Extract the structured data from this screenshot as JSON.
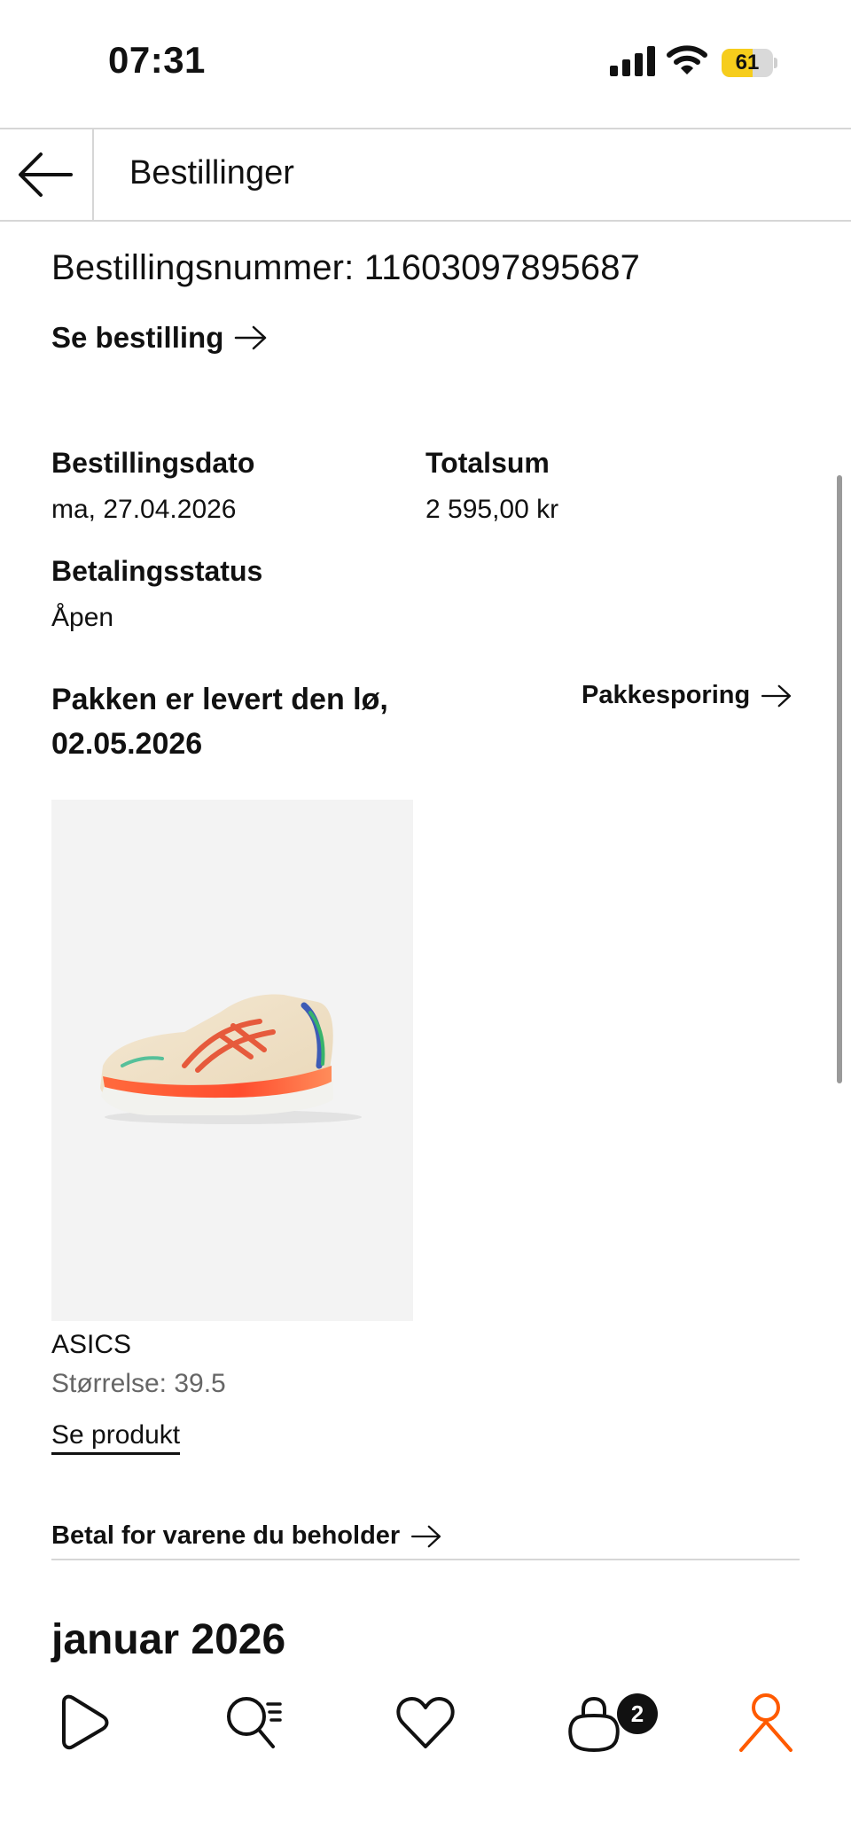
{
  "status_bar": {
    "time": "07:31",
    "battery": "61",
    "battery_level": 0.61
  },
  "header": {
    "title": "Bestillinger"
  },
  "order": {
    "number_label": "Bestillingsnummer: 11603097895687",
    "see_order": "Se bestilling",
    "order_date_label": "Bestillingsdato",
    "order_date": "ma, 27.04.2026",
    "total_label": "Totalsum",
    "total": "2 595,00 kr",
    "payment_status_label": "Betalingsstatus",
    "payment_status": "Åpen",
    "delivery_text": "Pakken er levert den lø, 02.05.2026",
    "tracking_link": "Pakkesporing"
  },
  "product": {
    "brand": "ASICS",
    "size": "Størrelse: 39.5",
    "see_product": "Se produkt",
    "image_icon": "running-shoe-image"
  },
  "pay_keep_link": "Betal for varene du beholder",
  "next_section": {
    "month": "januar 2026"
  },
  "tab_bar": {
    "items": [
      "home-icon",
      "search-icon",
      "heart-icon",
      "bag-icon",
      "profile-icon"
    ],
    "bag_badge": "2",
    "active": "profile-icon",
    "active_color": "#ff5a00"
  }
}
